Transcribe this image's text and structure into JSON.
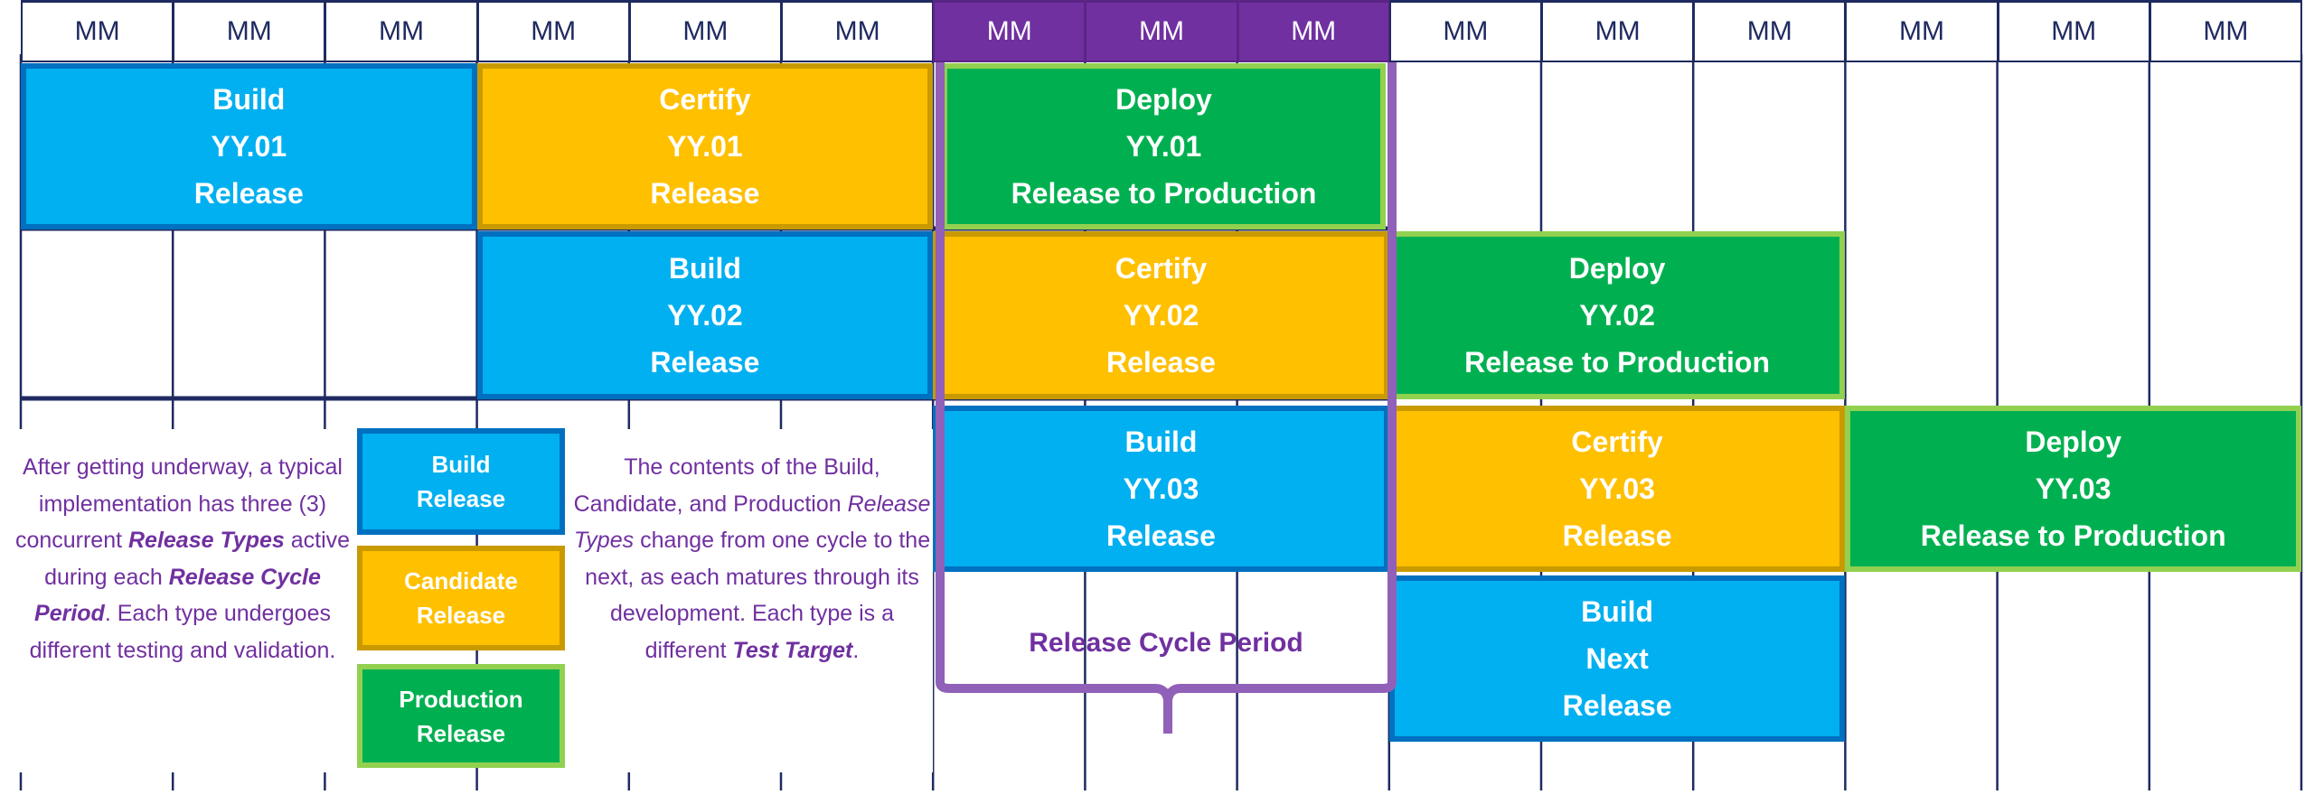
{
  "header": {
    "months": [
      "MM",
      "MM",
      "MM",
      "MM",
      "MM",
      "MM",
      "MM",
      "MM",
      "MM",
      "MM",
      "MM",
      "MM",
      "MM",
      "MM",
      "MM"
    ],
    "highlighted_columns": [
      6,
      7,
      8
    ]
  },
  "colors": {
    "build": "#00B0F0",
    "certify": "#FFC000",
    "deploy": "#00B050",
    "highlight": "#7030A0",
    "grid": "#1F2A60"
  },
  "releases": [
    {
      "phase": "Build",
      "version": "YY.01",
      "label": "Release"
    },
    {
      "phase": "Certify",
      "version": "YY.01",
      "label": "Release"
    },
    {
      "phase": "Deploy",
      "version": "YY.01",
      "label": "Release to Production"
    },
    {
      "phase": "Build",
      "version": "YY.02",
      "label": "Release"
    },
    {
      "phase": "Certify",
      "version": "YY.02",
      "label": "Release"
    },
    {
      "phase": "Deploy",
      "version": "YY.02",
      "label": "Release to Production"
    },
    {
      "phase": "Build",
      "version": "YY.03",
      "label": "Release"
    },
    {
      "phase": "Certify",
      "version": "YY.03",
      "label": "Release"
    },
    {
      "phase": "Deploy",
      "version": "YY.03",
      "label": "Release to Production"
    },
    {
      "phase": "Build",
      "version": "Next",
      "label": "Release"
    }
  ],
  "legend": [
    {
      "line1": "Build",
      "line2": "Release"
    },
    {
      "line1": "Candidate",
      "line2": "Release"
    },
    {
      "line1": "Production",
      "line2": "Release"
    }
  ],
  "left_note": {
    "s1": "After getting underway, a typical implementation has three (3) concurrent ",
    "e1": "Release Types",
    "s2": " active during each ",
    "e2": "Release Cycle Period",
    "s3": ".  Each type undergoes different testing and validation."
  },
  "middle_note": {
    "s1": "The contents of the Build, Candidate, and Production ",
    "i1": "Release Types",
    "s2": " change from one cycle to the next, as each matures through its development. Each type is a different ",
    "e1": "Test Target",
    "s3": "."
  },
  "bracket_label": "Release Cycle Period"
}
